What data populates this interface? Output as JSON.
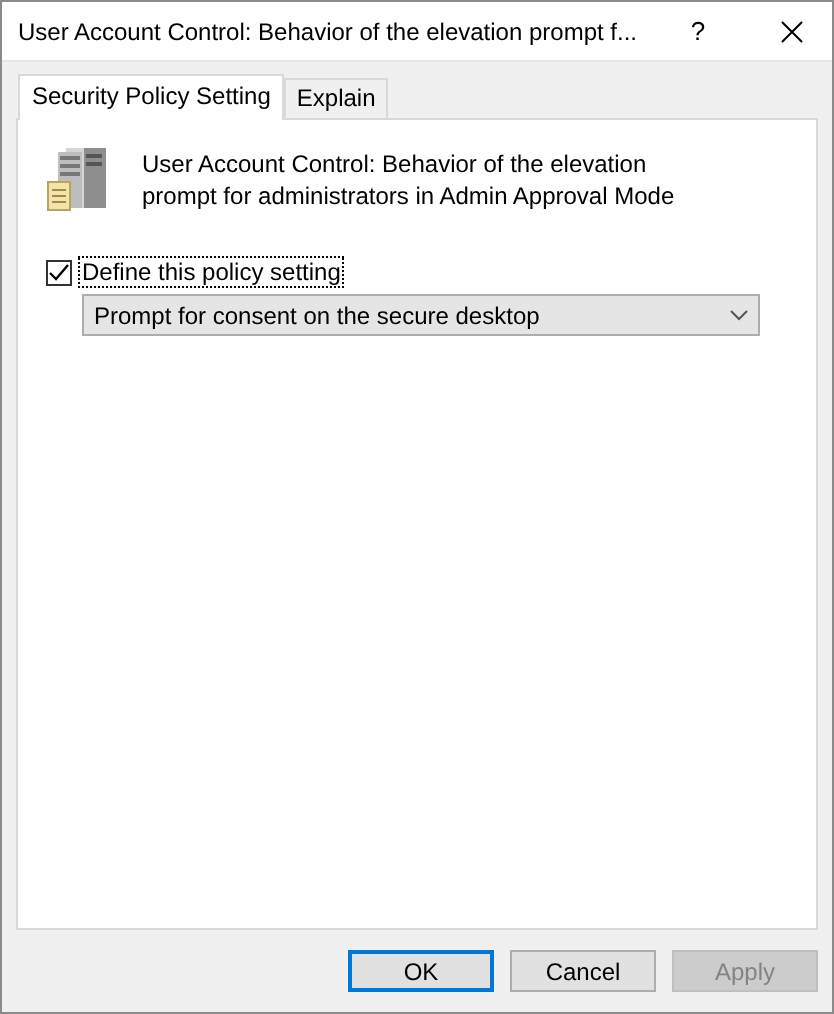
{
  "window": {
    "title": "User Account Control: Behavior of the elevation prompt f...",
    "help": "?"
  },
  "tabs": [
    {
      "label": "Security Policy Setting",
      "selected": true
    },
    {
      "label": "Explain",
      "selected": false
    }
  ],
  "policy": {
    "description": "User Account Control: Behavior of the elevation prompt for administrators in Admin Approval Mode"
  },
  "define": {
    "label": "Define this policy setting",
    "checked": true
  },
  "dropdown": {
    "value": "Prompt for consent on the secure desktop"
  },
  "buttons": [
    {
      "label": "OK",
      "kind": "default",
      "disabled": false
    },
    {
      "label": "Cancel",
      "kind": "normal",
      "disabled": false
    },
    {
      "label": "Apply",
      "kind": "normal",
      "disabled": true
    }
  ]
}
